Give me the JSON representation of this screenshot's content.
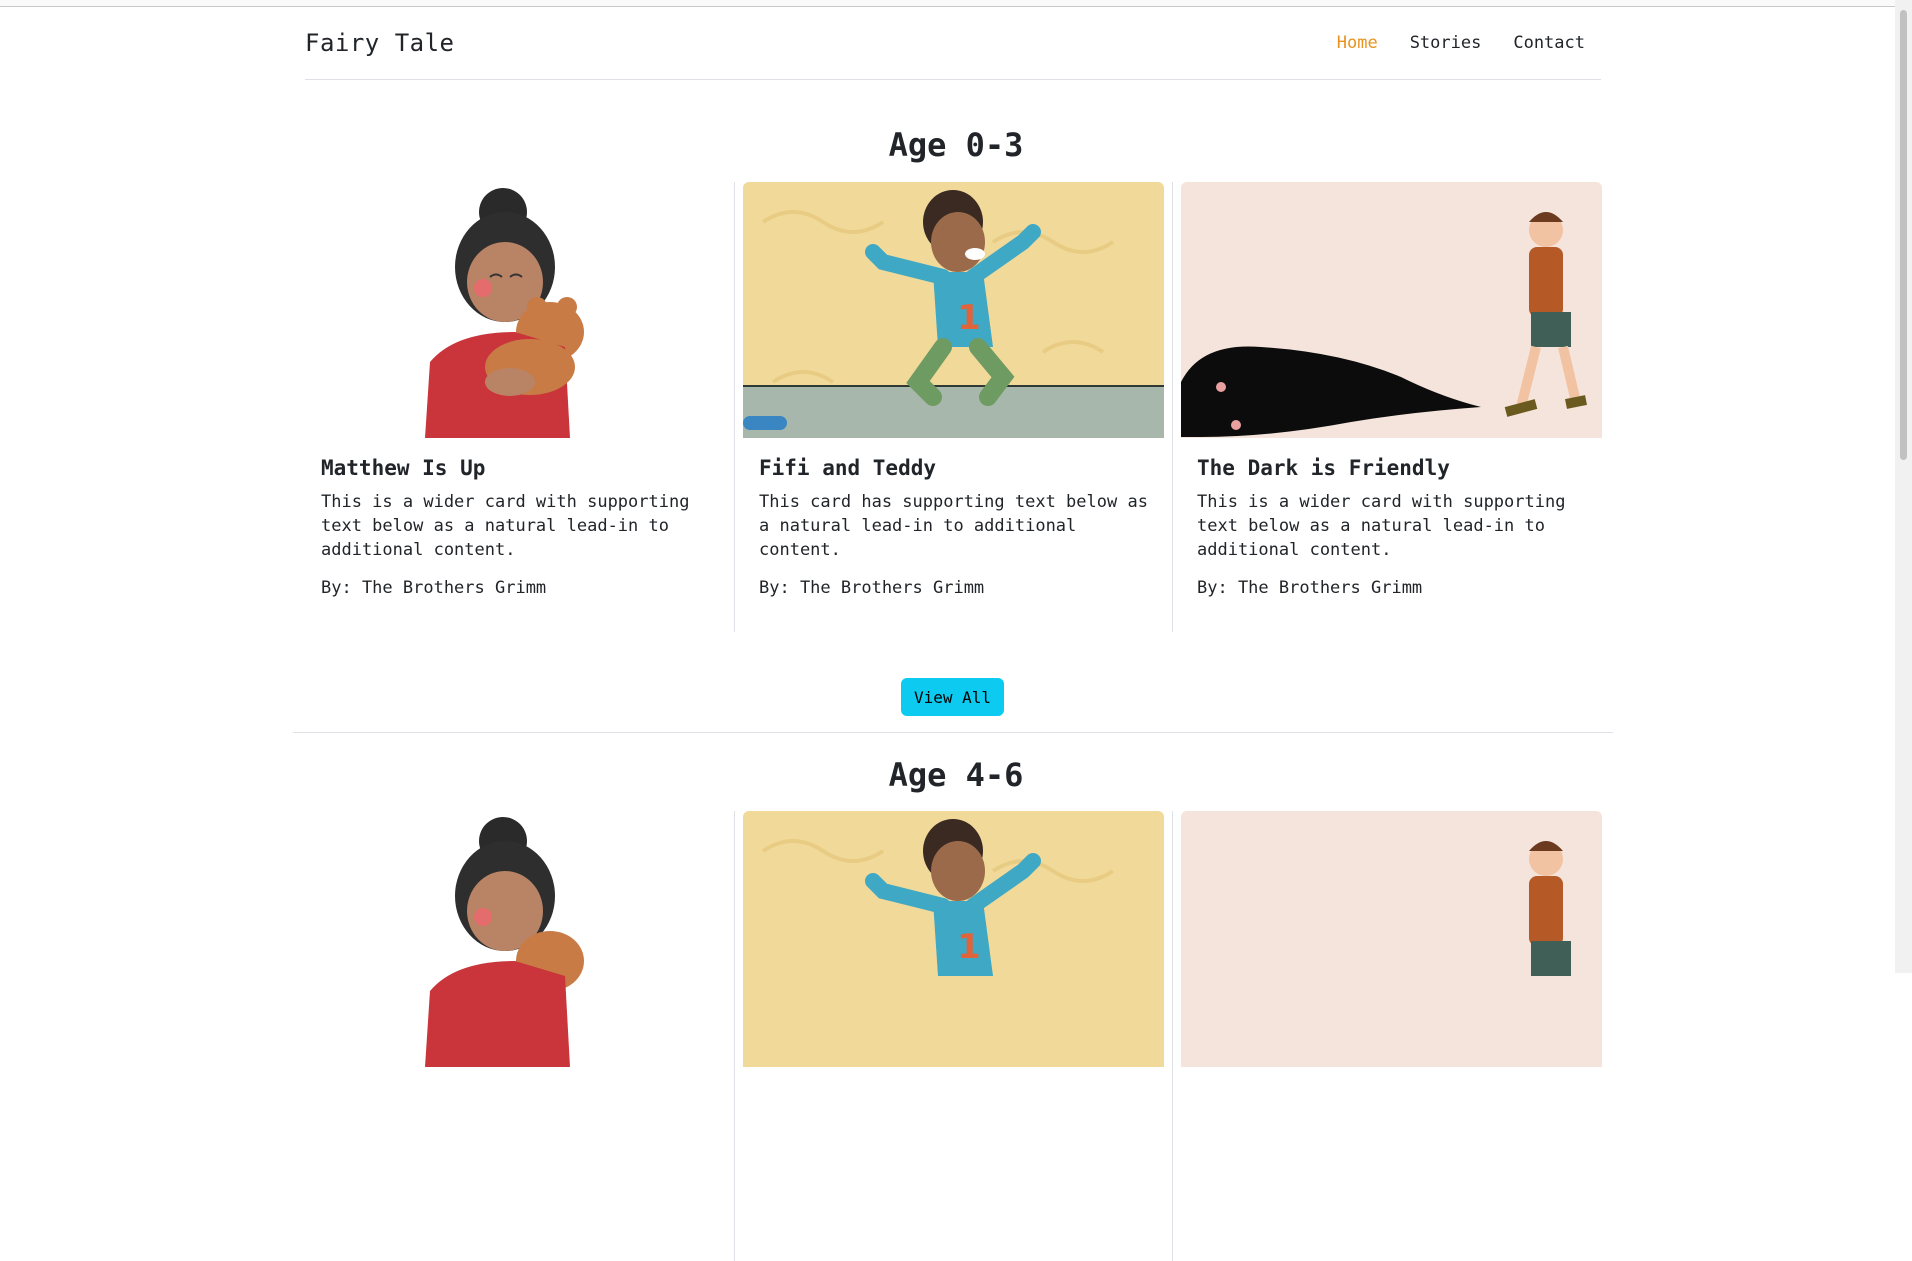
{
  "brand": "Fairy Tale",
  "nav": [
    "Home",
    "Stories",
    "Contact"
  ],
  "sections": [
    {
      "title": "Age 0-3",
      "button": "View All",
      "cards": [
        {
          "title": "Matthew Is Up",
          "text": "This is a wider card with supporting text below as a natural lead-in to additional content.",
          "author": "By: The Brothers Grimm"
        },
        {
          "title": "Fifi and Teddy",
          "text": "This card has supporting text below as a natural lead-in to additional content.",
          "author": "By: The Brothers Grimm"
        },
        {
          "title": "The Dark is Friendly",
          "text": "This is a wider card with supporting text below as a natural lead-in to additional content.",
          "author": "By: The Brothers Grimm"
        }
      ]
    },
    {
      "title": "Age 4-6"
    }
  ],
  "colors": {
    "accent": "#e89320",
    "button": "#0dcaf0"
  }
}
